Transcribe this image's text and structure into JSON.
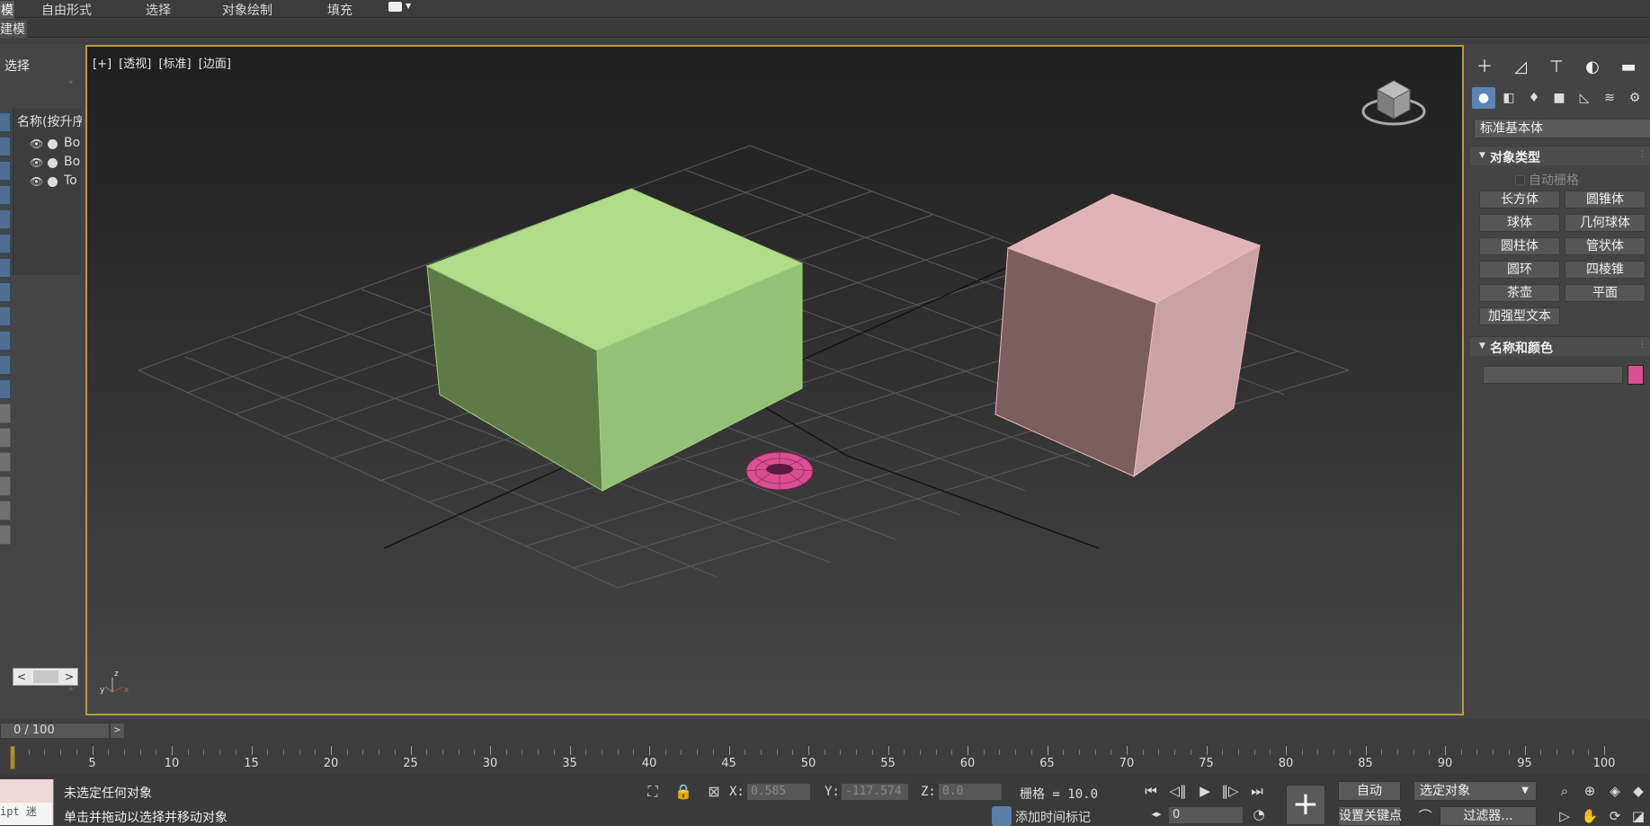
{
  "menubar": {
    "first_item": "模",
    "items": [
      "自由形式",
      "选择",
      "对象绘制",
      "填充"
    ]
  },
  "ribbon": {
    "label": "建模"
  },
  "scene_explorer": {
    "title": "选择",
    "list_header": "名称(按升序",
    "rows": [
      {
        "name": "Bo"
      },
      {
        "name": "Bo"
      },
      {
        "name": "To"
      }
    ]
  },
  "viewport": {
    "label": [
      "[+]",
      "[透视]",
      "[标准]",
      "[边面]"
    ],
    "axis_labels": {
      "x": "x",
      "y": "y",
      "z": "z"
    },
    "objects": [
      {
        "name": "Box",
        "color": "#b1dc8a"
      },
      {
        "name": "Box",
        "color": "#e8b4b6"
      },
      {
        "name": "Torus",
        "color": "#d94f92"
      }
    ],
    "border_color": "#b89a3d"
  },
  "command_panel": {
    "category_dropdown": "标准基本体",
    "object_type_title": "对象类型",
    "autogrid_label": "自动栅格",
    "buttons": [
      "长方体",
      "圆锥体",
      "球体",
      "几何球体",
      "圆柱体",
      "管状体",
      "圆环",
      "四棱锥",
      "茶壶",
      "平面",
      "加强型文本"
    ],
    "name_color_title": "名称和颜色",
    "object_color": "#d94f92",
    "active_tab_color": "#5d84b6"
  },
  "timeline": {
    "slider_text": "0 / 100",
    "ticks": [
      "5",
      "10",
      "15",
      "20",
      "25",
      "30",
      "35",
      "40",
      "45",
      "50",
      "55",
      "60",
      "65",
      "70",
      "75",
      "80",
      "85",
      "90",
      "95",
      "100"
    ]
  },
  "status": {
    "maxscript_text": "ipt 迷",
    "line1": "未选定任何对象",
    "line2": "单击并拖动以选择并移动对象",
    "x_label": "X:",
    "x_value": "0.585",
    "y_label": "Y:",
    "y_value": "-117.574",
    "z_label": "Z:",
    "z_value": "0.0",
    "grid": "栅格 = 10.0",
    "add_time_tag": "添加时间标记",
    "frame_value": "0",
    "auto_key": "自动",
    "set_key": "设置关键点",
    "selection_dropdown": "选定对象",
    "filters": "过滤器..."
  }
}
